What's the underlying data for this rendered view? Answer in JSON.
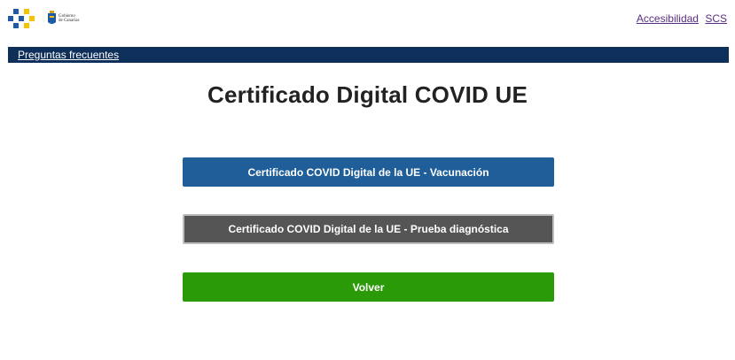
{
  "header": {
    "gov_logo_text": [
      "Gobierno",
      "de Canarias"
    ],
    "links": [
      "Accesibilidad",
      "SCS"
    ]
  },
  "nav": {
    "faq_label": "Preguntas frecuentes"
  },
  "main": {
    "title": "Certificado Digital COVID UE",
    "buttons": {
      "vaccination": "Certificado COVID Digital de la UE - Vacunación",
      "diagnostic_test": "Certificado COVID Digital de la UE - Prueba diagnóstica",
      "back": "Volver"
    }
  },
  "colors": {
    "navbar": "#0e2f5a",
    "vaccination_button": "#1f5e98",
    "diagnostic_button": "#555555",
    "back_button": "#2b9a08",
    "logo_blue": "#1e5aa8",
    "logo_yellow": "#f5c400"
  }
}
